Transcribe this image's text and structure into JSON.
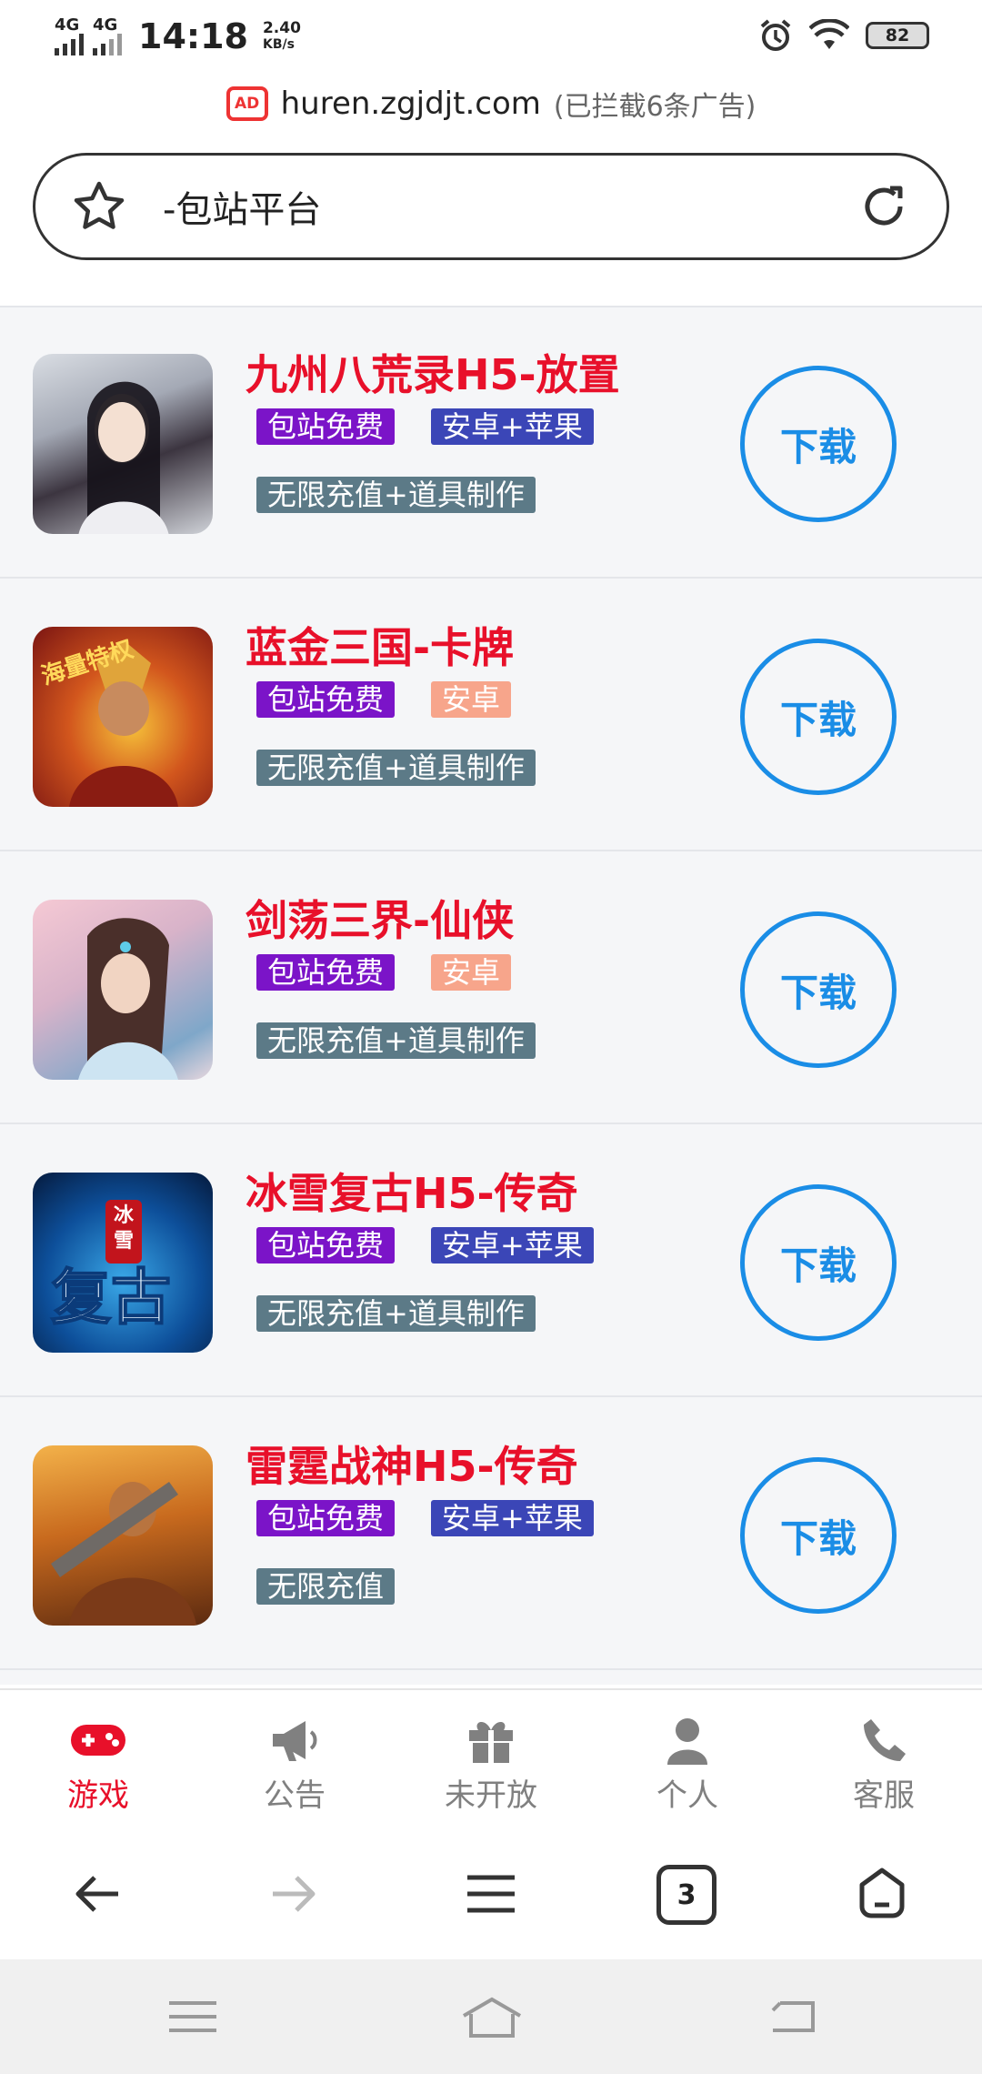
{
  "status": {
    "signal1": "4G",
    "signal2": "4G",
    "time": "14:18",
    "speed_value": "2.40",
    "speed_unit": "KB/s",
    "battery": "82"
  },
  "browser": {
    "ad_icon": "AD",
    "domain": "huren.zgjdjt.com",
    "blocked_note": "(已拦截6条广告)",
    "search_text": "-包站平台"
  },
  "games": [
    {
      "title": "九州八荒录H5-放置",
      "tag1": "包站免费",
      "tag2": "安卓+苹果",
      "tag3": "无限充值+道具制作",
      "download": "下载"
    },
    {
      "title": "蓝金三国-卡牌",
      "tag1": "包站免费",
      "tag2": "安卓",
      "tag3": "无限充值+道具制作",
      "download": "下载"
    },
    {
      "title": "剑荡三界-仙侠",
      "tag1": "包站免费",
      "tag2": "安卓",
      "tag3": "无限充值+道具制作",
      "download": "下载"
    },
    {
      "title": "冰雪复古H5-传奇",
      "tag1": "包站免费",
      "tag2": "安卓+苹果",
      "tag3": "无限充值+道具制作",
      "download": "下载",
      "thumb_text": "冰雪"
    },
    {
      "title": "雷霆战神H5-传奇",
      "tag1": "包站免费",
      "tag2": "安卓+苹果",
      "tag3": "无限充值",
      "download": "下载"
    }
  ],
  "tabs": [
    {
      "label": "游戏",
      "icon": "gamepad-icon",
      "active": true
    },
    {
      "label": "公告",
      "icon": "megaphone-icon",
      "active": false
    },
    {
      "label": "未开放",
      "icon": "gift-icon",
      "active": false
    },
    {
      "label": "个人",
      "icon": "person-icon",
      "active": false
    },
    {
      "label": "客服",
      "icon": "phone-icon",
      "active": false
    }
  ],
  "browser_nav": {
    "tab_count": "3"
  },
  "colors": {
    "accent_red": "#e8102a",
    "download_blue": "#1a8de6",
    "tag_purple": "#7b14c8",
    "tag_blue": "#3b46b7",
    "tag_salmon": "#f7a58b",
    "tag_slate": "#5c7a87"
  }
}
